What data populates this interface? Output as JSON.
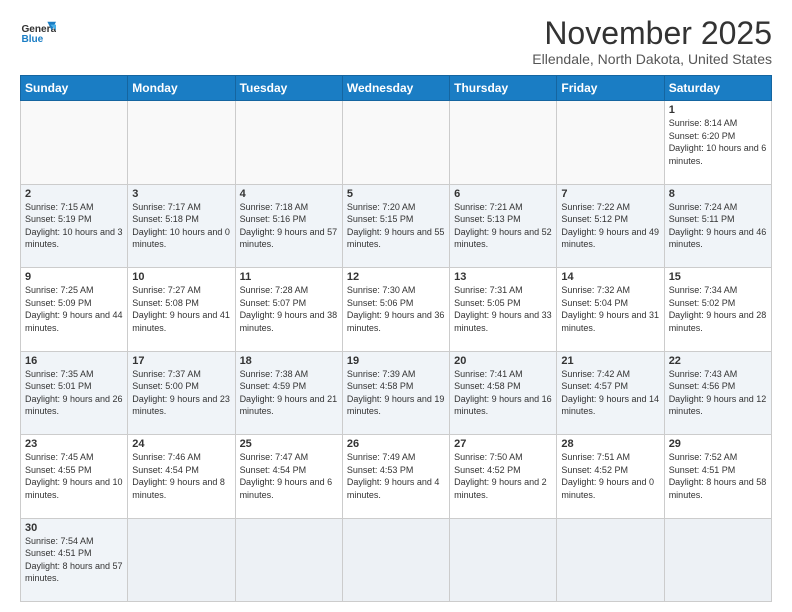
{
  "header": {
    "logo_general": "General",
    "logo_blue": "Blue",
    "month_title": "November 2025",
    "location": "Ellendale, North Dakota, United States"
  },
  "days_of_week": [
    "Sunday",
    "Monday",
    "Tuesday",
    "Wednesday",
    "Thursday",
    "Friday",
    "Saturday"
  ],
  "weeks": [
    {
      "days": [
        {
          "num": "",
          "info": ""
        },
        {
          "num": "",
          "info": ""
        },
        {
          "num": "",
          "info": ""
        },
        {
          "num": "",
          "info": ""
        },
        {
          "num": "",
          "info": ""
        },
        {
          "num": "",
          "info": ""
        },
        {
          "num": "1",
          "info": "Sunrise: 8:14 AM\nSunset: 6:20 PM\nDaylight: 10 hours and 6 minutes."
        }
      ]
    },
    {
      "days": [
        {
          "num": "2",
          "info": "Sunrise: 7:15 AM\nSunset: 5:19 PM\nDaylight: 10 hours and 3 minutes."
        },
        {
          "num": "3",
          "info": "Sunrise: 7:17 AM\nSunset: 5:18 PM\nDaylight: 10 hours and 0 minutes."
        },
        {
          "num": "4",
          "info": "Sunrise: 7:18 AM\nSunset: 5:16 PM\nDaylight: 9 hours and 57 minutes."
        },
        {
          "num": "5",
          "info": "Sunrise: 7:20 AM\nSunset: 5:15 PM\nDaylight: 9 hours and 55 minutes."
        },
        {
          "num": "6",
          "info": "Sunrise: 7:21 AM\nSunset: 5:13 PM\nDaylight: 9 hours and 52 minutes."
        },
        {
          "num": "7",
          "info": "Sunrise: 7:22 AM\nSunset: 5:12 PM\nDaylight: 9 hours and 49 minutes."
        },
        {
          "num": "8",
          "info": "Sunrise: 7:24 AM\nSunset: 5:11 PM\nDaylight: 9 hours and 46 minutes."
        }
      ]
    },
    {
      "days": [
        {
          "num": "9",
          "info": "Sunrise: 7:25 AM\nSunset: 5:09 PM\nDaylight: 9 hours and 44 minutes."
        },
        {
          "num": "10",
          "info": "Sunrise: 7:27 AM\nSunset: 5:08 PM\nDaylight: 9 hours and 41 minutes."
        },
        {
          "num": "11",
          "info": "Sunrise: 7:28 AM\nSunset: 5:07 PM\nDaylight: 9 hours and 38 minutes."
        },
        {
          "num": "12",
          "info": "Sunrise: 7:30 AM\nSunset: 5:06 PM\nDaylight: 9 hours and 36 minutes."
        },
        {
          "num": "13",
          "info": "Sunrise: 7:31 AM\nSunset: 5:05 PM\nDaylight: 9 hours and 33 minutes."
        },
        {
          "num": "14",
          "info": "Sunrise: 7:32 AM\nSunset: 5:04 PM\nDaylight: 9 hours and 31 minutes."
        },
        {
          "num": "15",
          "info": "Sunrise: 7:34 AM\nSunset: 5:02 PM\nDaylight: 9 hours and 28 minutes."
        }
      ]
    },
    {
      "days": [
        {
          "num": "16",
          "info": "Sunrise: 7:35 AM\nSunset: 5:01 PM\nDaylight: 9 hours and 26 minutes."
        },
        {
          "num": "17",
          "info": "Sunrise: 7:37 AM\nSunset: 5:00 PM\nDaylight: 9 hours and 23 minutes."
        },
        {
          "num": "18",
          "info": "Sunrise: 7:38 AM\nSunset: 4:59 PM\nDaylight: 9 hours and 21 minutes."
        },
        {
          "num": "19",
          "info": "Sunrise: 7:39 AM\nSunset: 4:58 PM\nDaylight: 9 hours and 19 minutes."
        },
        {
          "num": "20",
          "info": "Sunrise: 7:41 AM\nSunset: 4:58 PM\nDaylight: 9 hours and 16 minutes."
        },
        {
          "num": "21",
          "info": "Sunrise: 7:42 AM\nSunset: 4:57 PM\nDaylight: 9 hours and 14 minutes."
        },
        {
          "num": "22",
          "info": "Sunrise: 7:43 AM\nSunset: 4:56 PM\nDaylight: 9 hours and 12 minutes."
        }
      ]
    },
    {
      "days": [
        {
          "num": "23",
          "info": "Sunrise: 7:45 AM\nSunset: 4:55 PM\nDaylight: 9 hours and 10 minutes."
        },
        {
          "num": "24",
          "info": "Sunrise: 7:46 AM\nSunset: 4:54 PM\nDaylight: 9 hours and 8 minutes."
        },
        {
          "num": "25",
          "info": "Sunrise: 7:47 AM\nSunset: 4:54 PM\nDaylight: 9 hours and 6 minutes."
        },
        {
          "num": "26",
          "info": "Sunrise: 7:49 AM\nSunset: 4:53 PM\nDaylight: 9 hours and 4 minutes."
        },
        {
          "num": "27",
          "info": "Sunrise: 7:50 AM\nSunset: 4:52 PM\nDaylight: 9 hours and 2 minutes."
        },
        {
          "num": "28",
          "info": "Sunrise: 7:51 AM\nSunset: 4:52 PM\nDaylight: 9 hours and 0 minutes."
        },
        {
          "num": "29",
          "info": "Sunrise: 7:52 AM\nSunset: 4:51 PM\nDaylight: 8 hours and 58 minutes."
        }
      ]
    },
    {
      "days": [
        {
          "num": "30",
          "info": "Sunrise: 7:54 AM\nSunset: 4:51 PM\nDaylight: 8 hours and 57 minutes."
        },
        {
          "num": "",
          "info": ""
        },
        {
          "num": "",
          "info": ""
        },
        {
          "num": "",
          "info": ""
        },
        {
          "num": "",
          "info": ""
        },
        {
          "num": "",
          "info": ""
        },
        {
          "num": "",
          "info": ""
        }
      ]
    }
  ]
}
